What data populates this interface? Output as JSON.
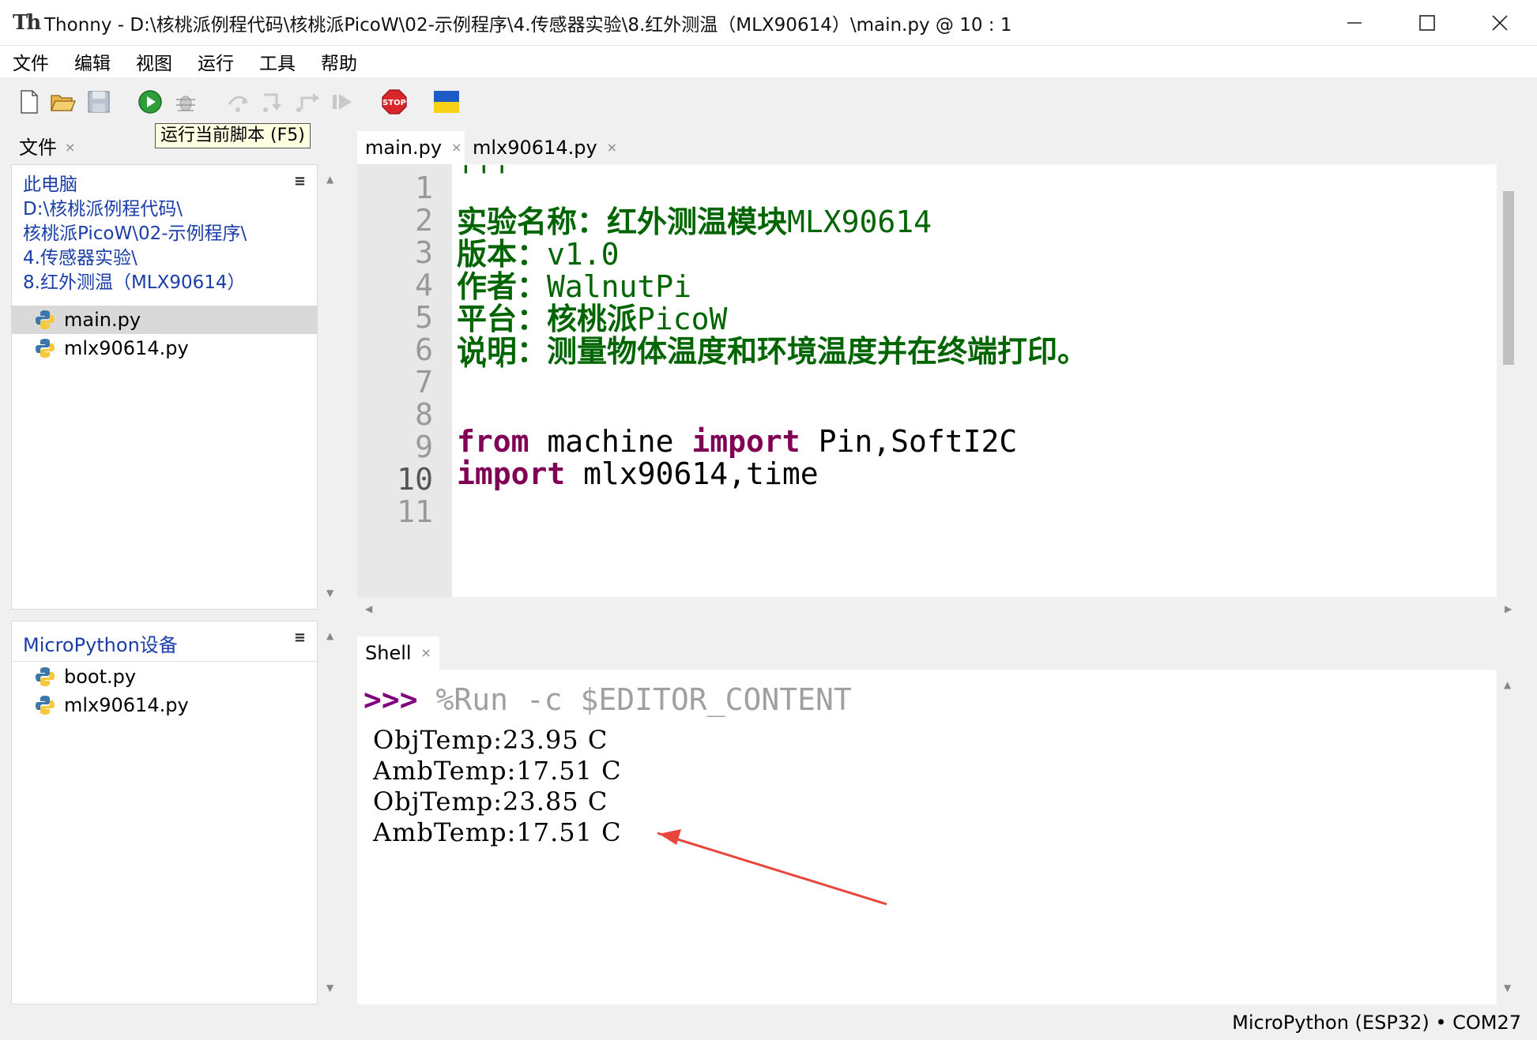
{
  "window": {
    "title": "Thonny  -  D:\\核桃派例程代码\\核桃派PicoW\\02-示例程序\\4.传感器实验\\8.红外测温（MLX90614）\\main.py  @  10 : 1",
    "app_icon": "Th"
  },
  "menu": {
    "items": [
      "文件",
      "编辑",
      "视图",
      "运行",
      "工具",
      "帮助"
    ]
  },
  "toolbar": {
    "tooltip": "运行当前脚本 (F5)",
    "icons": [
      "new-file-icon",
      "open-folder-icon",
      "save-icon",
      "run-icon",
      "debug-icon",
      "step-over-icon",
      "step-into-icon",
      "step-out-icon",
      "resume-icon",
      "stop-icon",
      "ukraine-flag-icon"
    ]
  },
  "files_panel": {
    "tab_label": "文件",
    "close": "×",
    "menu": "≡",
    "path": [
      "此电脑",
      "D:\\核桃派例程代码\\",
      "核桃派PicoW\\02-示例程序\\",
      "4.传感器实验\\",
      "8.红外测温（MLX90614）"
    ],
    "files": [
      "main.py",
      "mlx90614.py"
    ]
  },
  "device_panel": {
    "title": "MicroPython设备",
    "menu": "≡",
    "files": [
      "boot.py",
      "mlx90614.py"
    ]
  },
  "editor": {
    "tabs": [
      "main.py",
      "mlx90614.py"
    ],
    "close": "×",
    "line_numbers": [
      "1",
      "2",
      "3",
      "4",
      "5",
      "6",
      "7",
      "8",
      "9",
      "10",
      "11"
    ],
    "line1": "'''",
    "line2_label": "实验名称：红外测温模块",
    "line2_value": "MLX90614",
    "line3_label": "版本：",
    "line3_value": "v1.0",
    "line4_label": "作者：",
    "line4_value": "WalnutPi",
    "line5_label": "平台：核桃派",
    "line5_value": "PicoW",
    "line6_label": "说明：测量物体温度和环境温度并在终端打印。",
    "line7": "'''",
    "line9_kw1": "from",
    "line9_mod": " machine ",
    "line9_kw2": "import",
    "line9_rest": " Pin,SoftI2C",
    "line10_kw": "import",
    "line10_rest": " mlx90614,time"
  },
  "shell": {
    "tab_label": "Shell",
    "close": "×",
    "prompt": ">>>",
    "command": " %Run -c $EDITOR_CONTENT",
    "output": [
      "ObjTemp:23.95 C",
      "AmbTemp:17.51 C",
      "ObjTemp:23.85 C",
      "AmbTemp:17.51 C"
    ]
  },
  "status": {
    "text": "MicroPython (ESP32)  •  COM27"
  },
  "colors": {
    "string": "#006400",
    "keyword": "#7f0055",
    "prompt": "#800080",
    "annotation_arrow": "#e8453c"
  }
}
